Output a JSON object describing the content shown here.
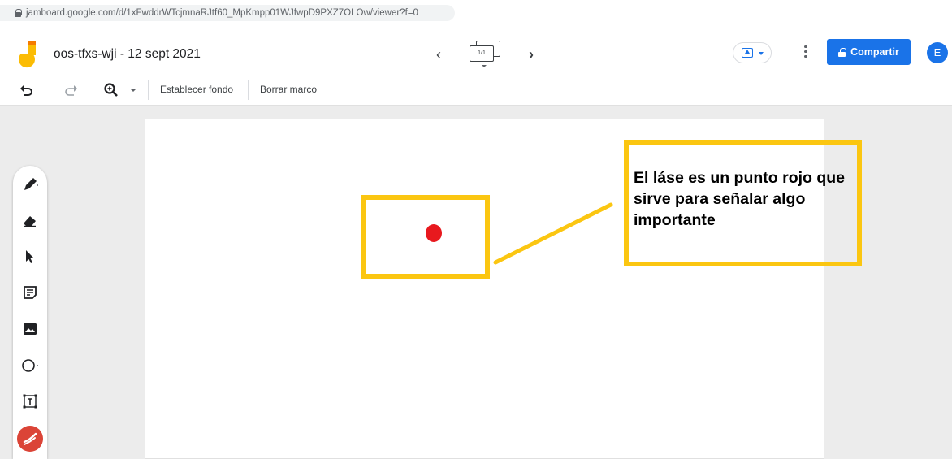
{
  "browser": {
    "url": "jamboard.google.com/d/1xFwddrWTcjmnaRJtf60_MpKmpp01WJfwpD9PXZ7OLOw/viewer?f=0"
  },
  "header": {
    "title": "oos-tfxs-wji - 12 sept 2021",
    "frame_counter": "1/1",
    "prev_icon": "chevron-left-icon",
    "next_icon": "chevron-right-icon",
    "share_label": "Compartir",
    "avatar_letter": "E"
  },
  "toolbar": {
    "set_background": "Establecer fondo",
    "clear_frame": "Borrar marco"
  },
  "tools": [
    "pen-icon",
    "eraser-icon",
    "select-icon",
    "sticky-note-icon",
    "image-icon",
    "circle-icon",
    "text-box-icon",
    "laser-icon"
  ],
  "board": {
    "note_text": "El láse es un punto rojo que sirve para señalar algo importante",
    "highlight_color": "#fbc611",
    "laser_dot_color": "#e8191e"
  },
  "colors": {
    "accent": "#1a73e8",
    "laser_button": "#db4437"
  }
}
